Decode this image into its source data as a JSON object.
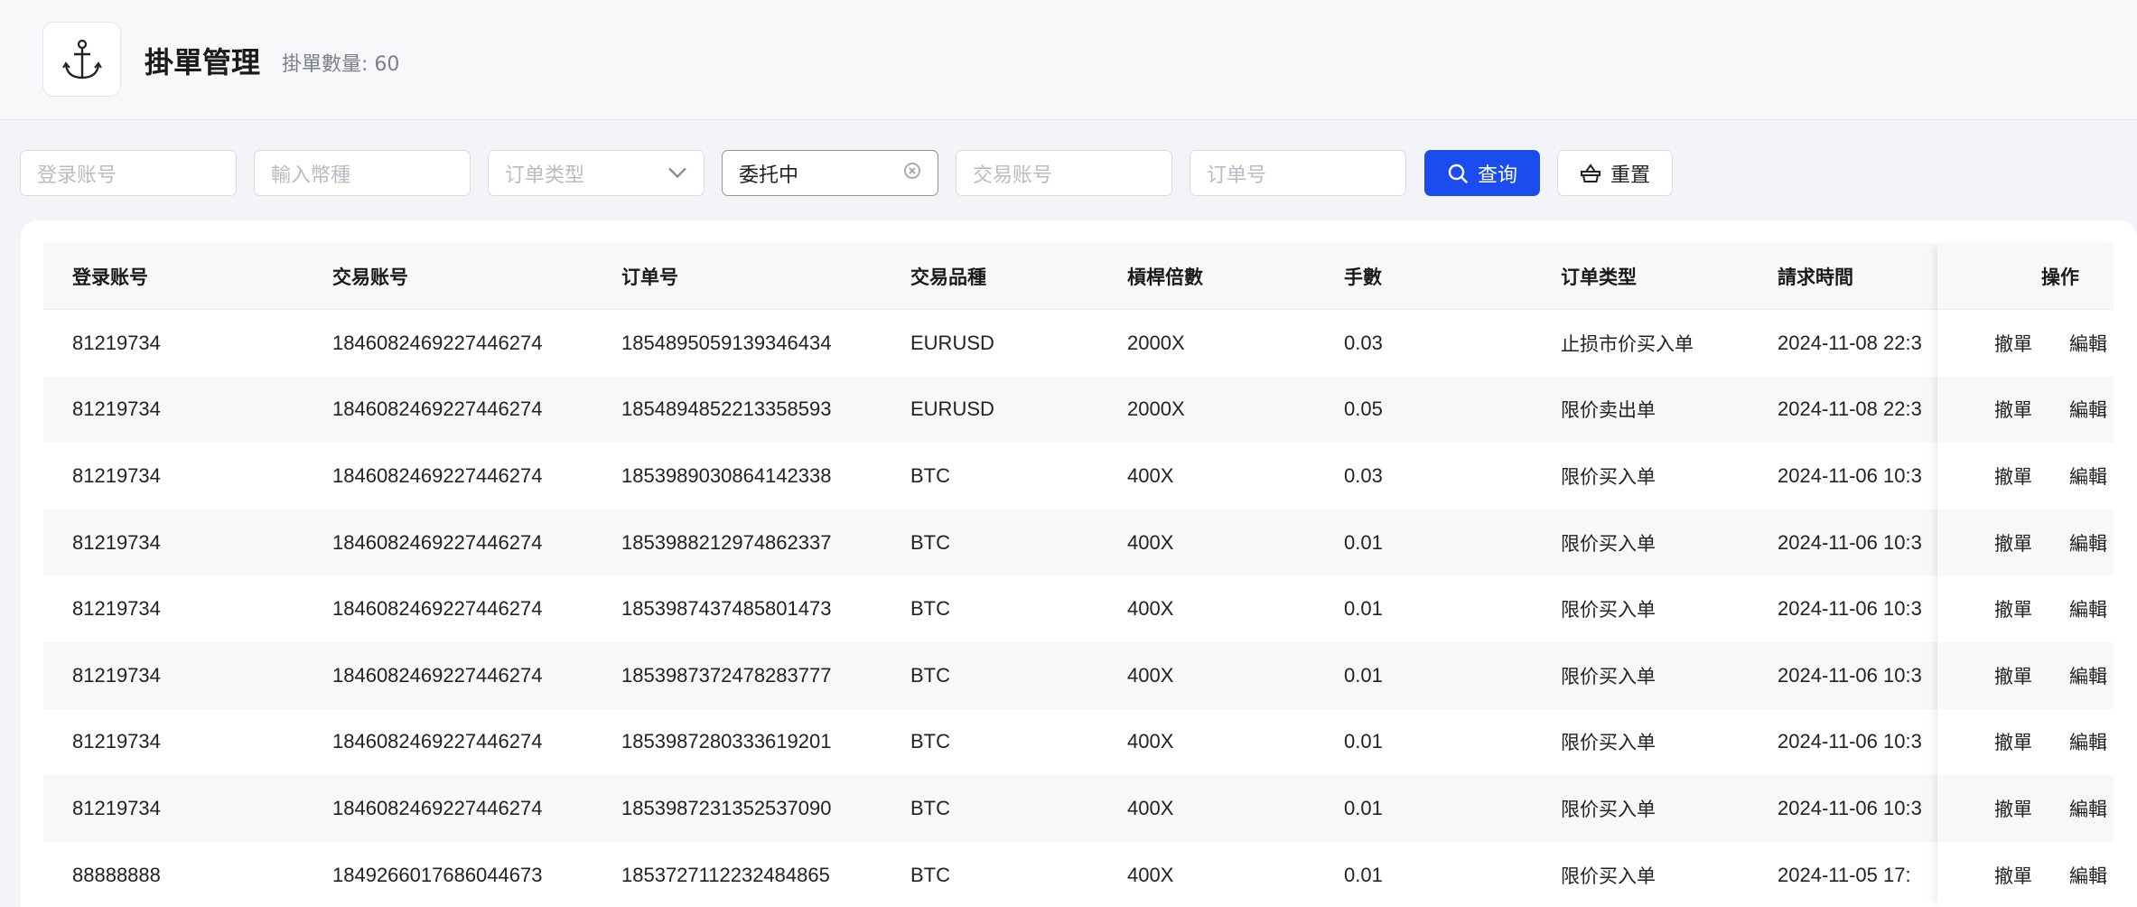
{
  "header": {
    "title": "掛單管理",
    "count_text": "掛單數量: 60",
    "logo_icon": "anchor-icon"
  },
  "filters": {
    "login_account_placeholder": "登录账号",
    "currency_placeholder": "輸入幣種",
    "order_type_placeholder": "订单类型",
    "status_value": "委托中",
    "trade_account_placeholder": "交易账号",
    "order_no_placeholder": "订单号",
    "query_label": "查询",
    "reset_label": "重置"
  },
  "table": {
    "columns": [
      "登录账号",
      "交易账号",
      "订单号",
      "交易品種",
      "槓桿倍數",
      "手數",
      "订单类型",
      "請求時間",
      "操作"
    ],
    "action_cancel": "撤單",
    "action_edit": "編輯",
    "rows": [
      {
        "login": "81219734",
        "account": "1846082469227446274",
        "order": "1854895059139346434",
        "symbol": "EURUSD",
        "leverage": "2000X",
        "lots": "0.03",
        "type": "止损市价买入单",
        "time": "2024-11-08 22:3"
      },
      {
        "login": "81219734",
        "account": "1846082469227446274",
        "order": "1854894852213358593",
        "symbol": "EURUSD",
        "leverage": "2000X",
        "lots": "0.05",
        "type": "限价卖出单",
        "time": "2024-11-08 22:3"
      },
      {
        "login": "81219734",
        "account": "1846082469227446274",
        "order": "1853989030864142338",
        "symbol": "BTC",
        "leverage": "400X",
        "lots": "0.03",
        "type": "限价买入单",
        "time": "2024-11-06 10:3"
      },
      {
        "login": "81219734",
        "account": "1846082469227446274",
        "order": "1853988212974862337",
        "symbol": "BTC",
        "leverage": "400X",
        "lots": "0.01",
        "type": "限价买入单",
        "time": "2024-11-06 10:3"
      },
      {
        "login": "81219734",
        "account": "1846082469227446274",
        "order": "1853987437485801473",
        "symbol": "BTC",
        "leverage": "400X",
        "lots": "0.01",
        "type": "限价买入单",
        "time": "2024-11-06 10:3"
      },
      {
        "login": "81219734",
        "account": "1846082469227446274",
        "order": "1853987372478283777",
        "symbol": "BTC",
        "leverage": "400X",
        "lots": "0.01",
        "type": "限价买入单",
        "time": "2024-11-06 10:3"
      },
      {
        "login": "81219734",
        "account": "1846082469227446274",
        "order": "1853987280333619201",
        "symbol": "BTC",
        "leverage": "400X",
        "lots": "0.01",
        "type": "限价买入单",
        "time": "2024-11-06 10:3"
      },
      {
        "login": "81219734",
        "account": "1846082469227446274",
        "order": "1853987231352537090",
        "symbol": "BTC",
        "leverage": "400X",
        "lots": "0.01",
        "type": "限价买入单",
        "time": "2024-11-06 10:3"
      },
      {
        "login": "88888888",
        "account": "1849266017686044673",
        "order": "1853727112232484865",
        "symbol": "BTC",
        "leverage": "400X",
        "lots": "0.01",
        "type": "限价买入单",
        "time": "2024-11-05 17:"
      }
    ]
  }
}
